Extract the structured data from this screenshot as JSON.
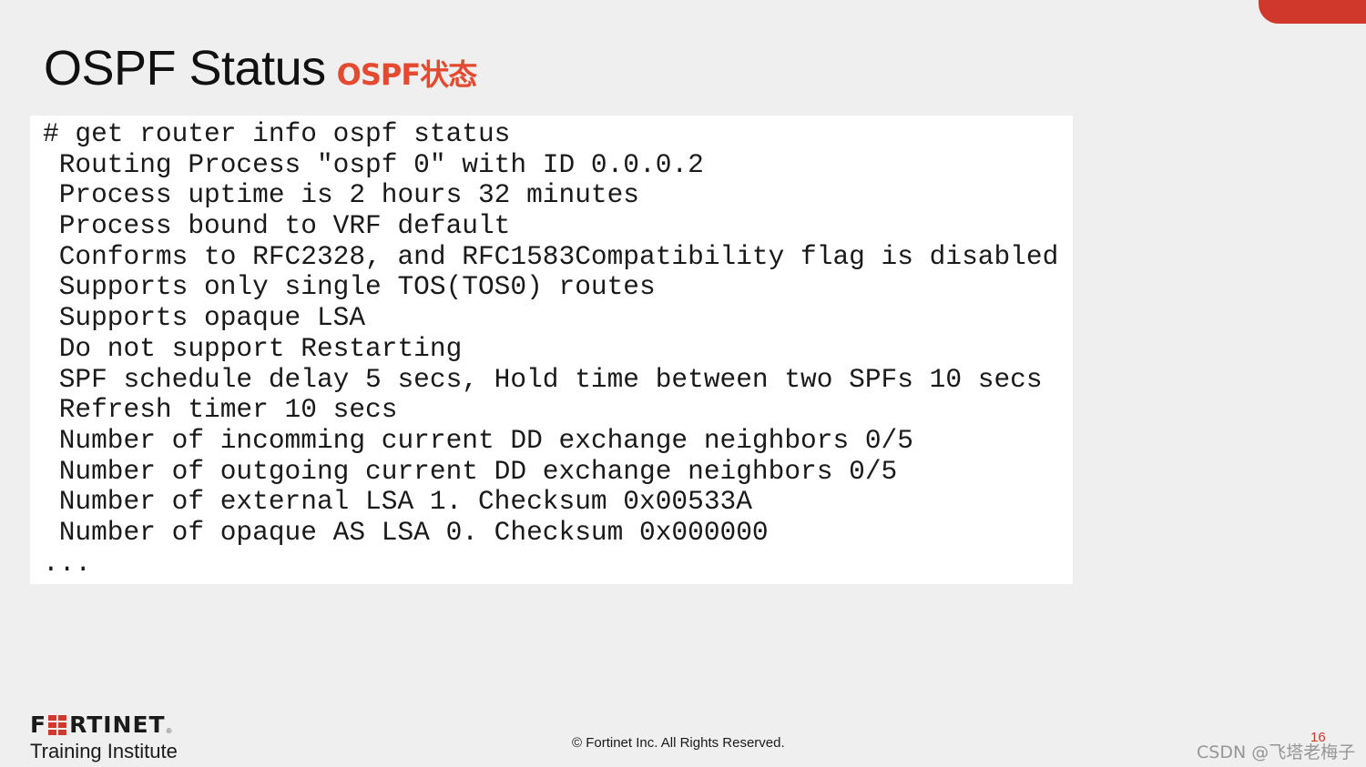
{
  "slide": {
    "title": "OSPF Status",
    "title_translation": "OSPF状态",
    "accent_color": "#d0382b",
    "translation_color": "#e44a2f"
  },
  "code": {
    "lines": [
      "# get router info ospf status",
      " Routing Process \"ospf 0\" with ID 0.0.0.2",
      " Process uptime is 2 hours 32 minutes",
      " Process bound to VRF default",
      " Conforms to RFC2328, and RFC1583Compatibility flag is disabled",
      " Supports only single TOS(TOS0) routes",
      " Supports opaque LSA",
      " Do not support Restarting",
      " SPF schedule delay 5 secs, Hold time between two SPFs 10 secs",
      " Refresh timer 10 secs",
      " Number of incomming current DD exchange neighbors 0/5",
      " Number of outgoing current DD exchange neighbors 0/5",
      " Number of external LSA 1. Checksum 0x00533A",
      " Number of opaque AS LSA 0. Checksum 0x000000",
      "..."
    ]
  },
  "footer": {
    "logo": {
      "prefix": "F",
      "suffix": "RTINET",
      "registered": "®",
      "icon": "fortinet-grid-logo-icon"
    },
    "subtitle": "Training Institute",
    "copyright": "© Fortinet Inc. All Rights Reserved.",
    "page_number": "16",
    "watermark": "CSDN @飞塔老梅子"
  }
}
